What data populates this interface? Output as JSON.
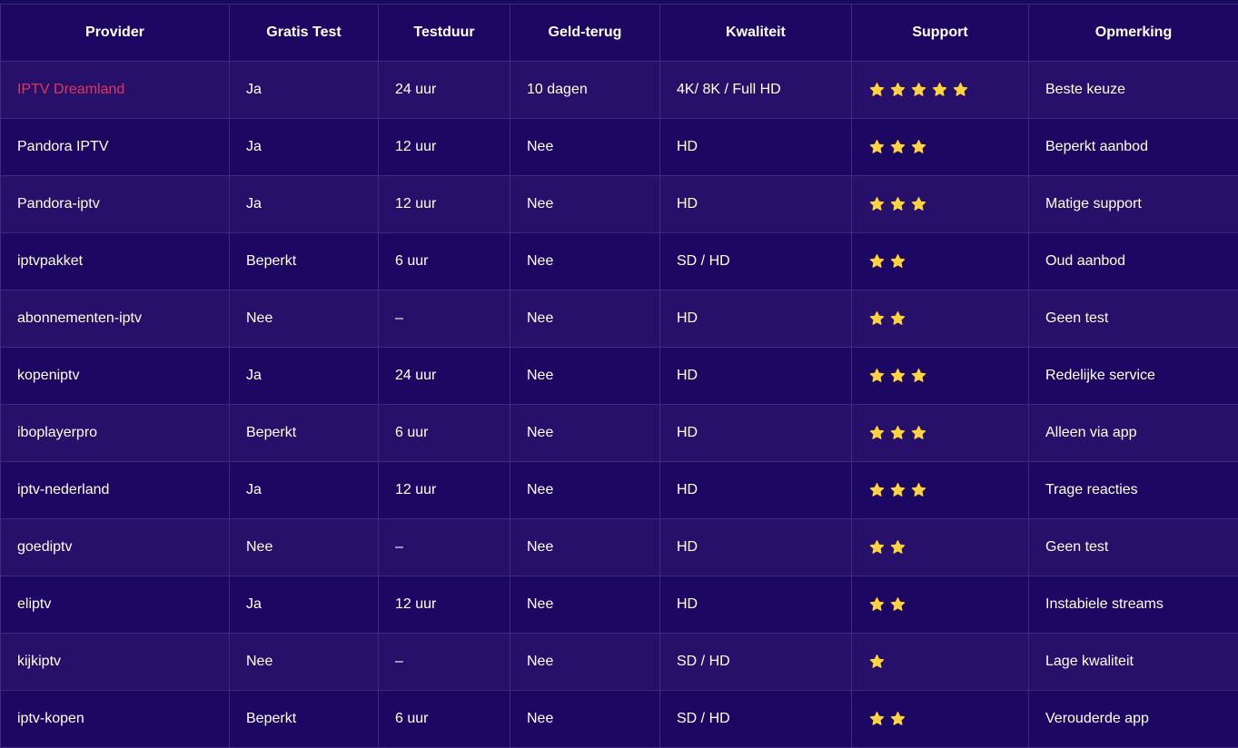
{
  "table": {
    "headers": [
      "Provider",
      "Gratis Test",
      "Testduur",
      "Geld-terug",
      "Kwaliteit",
      "Support",
      "Opmerking"
    ],
    "rows": [
      {
        "provider": "IPTV Dreamland",
        "free_test": "Ja",
        "duration": "24 uur",
        "money_back": "10 dagen",
        "quality": "4K/ 8K / Full HD",
        "support_stars": 5,
        "remark": "Beste keuze",
        "highlight": true
      },
      {
        "provider": "Pandora IPTV",
        "free_test": "Ja",
        "duration": "12 uur",
        "money_back": "Nee",
        "quality": "HD",
        "support_stars": 3,
        "remark": "Beperkt aanbod"
      },
      {
        "provider": "Pandora-iptv",
        "free_test": "Ja",
        "duration": "12 uur",
        "money_back": "Nee",
        "quality": "HD",
        "support_stars": 3,
        "remark": "Matige support"
      },
      {
        "provider": "iptvpakket",
        "free_test": "Beperkt",
        "duration": "6 uur",
        "money_back": "Nee",
        "quality": "SD / HD",
        "support_stars": 2,
        "remark": "Oud aanbod"
      },
      {
        "provider": "abonnementen-iptv",
        "free_test": "Nee",
        "duration": "–",
        "money_back": "Nee",
        "quality": "HD",
        "support_stars": 2,
        "remark": "Geen test"
      },
      {
        "provider": "kopeniptv",
        "free_test": "Ja",
        "duration": "24 uur",
        "money_back": "Nee",
        "quality": "HD",
        "support_stars": 3,
        "remark": "Redelijke service"
      },
      {
        "provider": "iboplayerpro",
        "free_test": "Beperkt",
        "duration": "6 uur",
        "money_back": "Nee",
        "quality": "HD",
        "support_stars": 3,
        "remark": "Alleen via app"
      },
      {
        "provider": "iptv-nederland",
        "free_test": "Ja",
        "duration": "12 uur",
        "money_back": "Nee",
        "quality": "HD",
        "support_stars": 3,
        "remark": "Trage reacties"
      },
      {
        "provider": "goediptv",
        "free_test": "Nee",
        "duration": "–",
        "money_back": "Nee",
        "quality": "HD",
        "support_stars": 2,
        "remark": "Geen test"
      },
      {
        "provider": "eliptv",
        "free_test": "Ja",
        "duration": "12 uur",
        "money_back": "Nee",
        "quality": "HD",
        "support_stars": 2,
        "remark": "Instabiele streams"
      },
      {
        "provider": "kijkiptv",
        "free_test": "Nee",
        "duration": "–",
        "money_back": "Nee",
        "quality": "SD / HD",
        "support_stars": 1,
        "remark": "Lage kwaliteit"
      },
      {
        "provider": "iptv-kopen",
        "free_test": "Beperkt",
        "duration": "6 uur",
        "money_back": "Nee",
        "quality": "SD / HD",
        "support_stars": 2,
        "remark": "Verouderde app"
      }
    ]
  },
  "colors": {
    "background": "#1a0a5e",
    "row_alt": "#26106a",
    "border": "#3a2a82",
    "highlight": "#e0365f",
    "star": "#ffd23f"
  },
  "icons": {
    "rating": "star-icon"
  }
}
